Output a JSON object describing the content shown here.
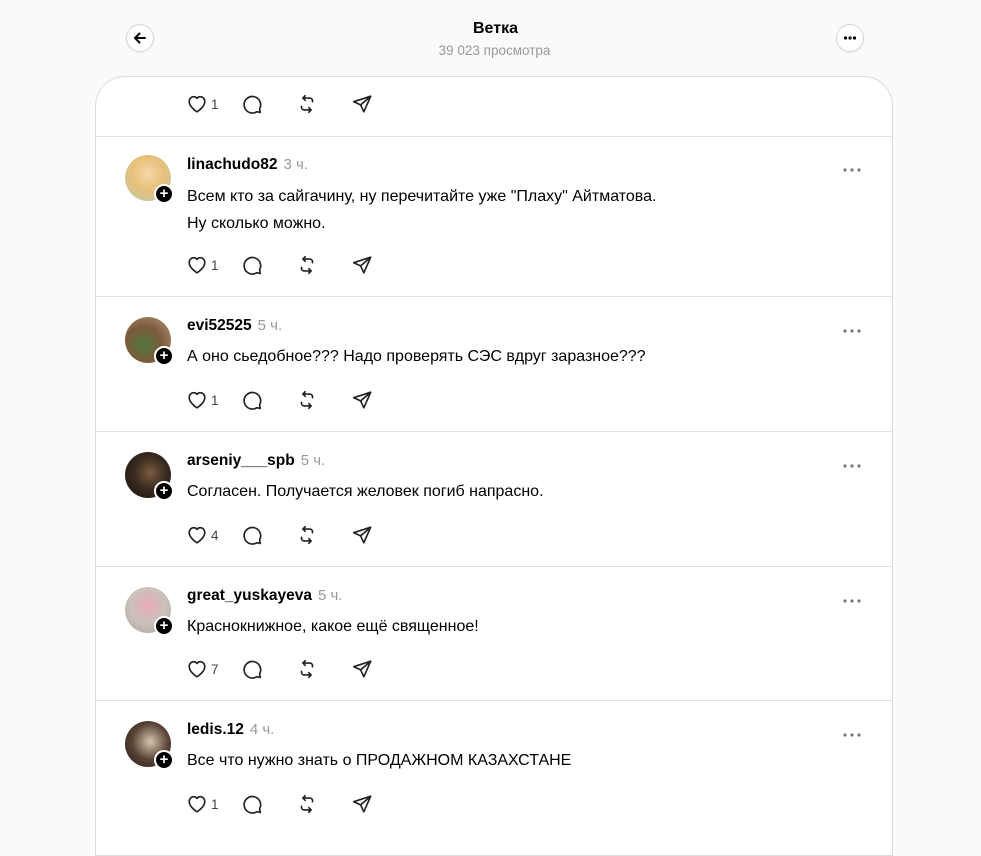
{
  "header": {
    "title": "Ветка",
    "views": "39 023 просмотра",
    "back_icon": "arrow-left-icon",
    "more_icon": "more-horizontal-icon"
  },
  "top_post": {
    "likes": "1"
  },
  "posts": [
    {
      "username": "linachudo82",
      "time": "3 ч.",
      "text": "Всем кто за сайгачину, ну перечитайте уже \"Плаху\" Айтматова.\nНу сколько можно.",
      "likes": "1"
    },
    {
      "username": "evi52525",
      "time": "5 ч.",
      "text": "А оно сьедобное??? Надо проверять СЭС вдруг заразное???",
      "likes": "1"
    },
    {
      "username": "arseniy___spb",
      "time": "5 ч.",
      "text": "Согласен. Получается желовек погиб напрасно.",
      "likes": "4"
    },
    {
      "username": "great_yuskayeva",
      "time": "5 ч.",
      "text": "Краснокнижное, какое ещё священное!",
      "likes": "7"
    },
    {
      "username": "ledis.12",
      "time": "4 ч.",
      "text": "Все что нужно знать о ПРОДАЖНОМ КАЗАХСТАНЕ",
      "likes": "1"
    }
  ],
  "icons": {
    "like": "heart-icon",
    "reply": "comment-icon",
    "repost": "repost-icon",
    "share": "send-icon",
    "follow": "plus-icon"
  },
  "colors": {
    "background": "#fafafa",
    "card": "#ffffff",
    "muted": "#999999",
    "divider": "#e2e2e2"
  }
}
